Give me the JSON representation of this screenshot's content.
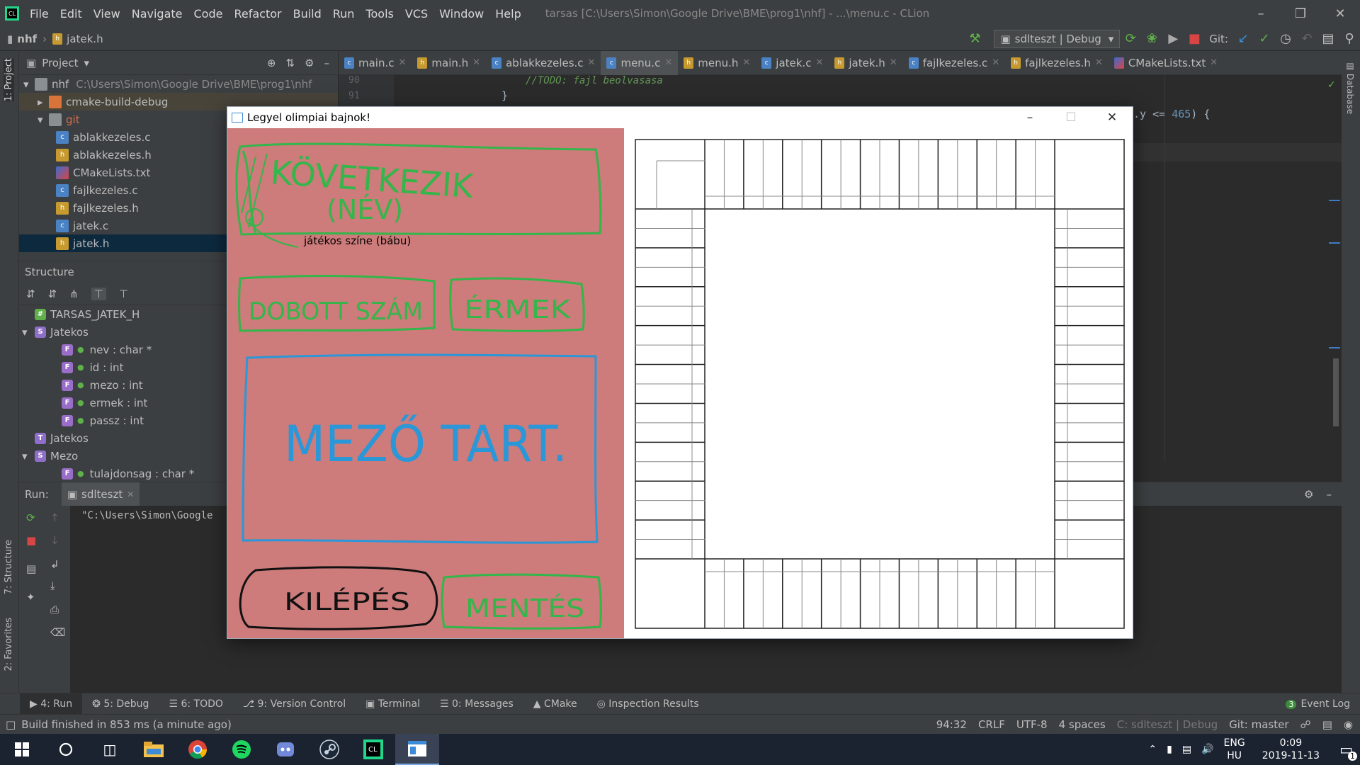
{
  "menu": [
    "File",
    "Edit",
    "View",
    "Navigate",
    "Code",
    "Refactor",
    "Build",
    "Run",
    "Tools",
    "VCS",
    "Window",
    "Help"
  ],
  "window_title": "tarsas [C:\\Users\\Simon\\Google Drive\\BME\\prog1\\nhf] - ...\\menu.c - CLion",
  "breadcrumb": {
    "project": "nhf",
    "file": "jatek.h"
  },
  "run_config": "sdlteszt | Debug",
  "git_label": "Git:",
  "project_panel": {
    "title": "Project",
    "tree": [
      {
        "label": "nhf",
        "extra": "C:\\Users\\Simon\\Google Drive\\BME\\prog1\\nhf",
        "kind": "folder"
      },
      {
        "label": "cmake-build-debug",
        "kind": "folder-orange"
      },
      {
        "label": "git",
        "kind": "folder"
      },
      {
        "label": "ablakkezeles.c",
        "kind": "c"
      },
      {
        "label": "ablakkezeles.h",
        "kind": "h"
      },
      {
        "label": "CMakeLists.txt",
        "kind": "cmake"
      },
      {
        "label": "fajlkezeles.c",
        "kind": "c"
      },
      {
        "label": "fajlkezeles.h",
        "kind": "h"
      },
      {
        "label": "jatek.c",
        "kind": "c"
      },
      {
        "label": "jatek.h",
        "kind": "h"
      }
    ]
  },
  "structure_panel": {
    "title": "Structure",
    "items": [
      {
        "badge": "#",
        "label": "TARSAS_JATEK_H",
        "level": 0
      },
      {
        "badge": "S",
        "label": "Jatekos",
        "level": 0
      },
      {
        "badge": "F",
        "label": "nev : char *",
        "level": 1
      },
      {
        "badge": "F",
        "label": "id : int",
        "level": 1
      },
      {
        "badge": "F",
        "label": "mezo : int",
        "level": 1
      },
      {
        "badge": "F",
        "label": "ermek : int",
        "level": 1
      },
      {
        "badge": "F",
        "label": "passz : int",
        "level": 1
      },
      {
        "badge": "T",
        "label": "Jatekos",
        "level": 0
      },
      {
        "badge": "S",
        "label": "Mezo",
        "level": 0
      },
      {
        "badge": "F",
        "label": "tulajdonsag : char *",
        "level": 1
      }
    ]
  },
  "tabs": [
    "main.c",
    "main.h",
    "ablakkezeles.c",
    "menu.c",
    "menu.h",
    "jatek.c",
    "jatek.h",
    "fajlkezeles.c",
    "fajlkezeles.h",
    "CMakeLists.txt"
  ],
  "editor": {
    "line_numbers": [
      "90",
      "91"
    ],
    "comment": "//TODO: fajl beolvasasa",
    "brace": "}",
    "snippet_prefix": ".y <= ",
    "snippet_number": "465",
    "snippet_suffix": ") {"
  },
  "run_panel": {
    "label": "Run:",
    "config": "sdlteszt",
    "output": "\"C:\\Users\\Simon\\Google"
  },
  "left_vertical_tabs": [
    "1: Project",
    "7: Structure",
    "2: Favorites"
  ],
  "right_vertical_tab": "Database",
  "bottom_tabs": [
    "4: Run",
    "5: Debug",
    "6: TODO",
    "9: Version Control",
    "Terminal",
    "0: Messages",
    "CMake",
    "Inspection Results"
  ],
  "event_log": {
    "count": "3",
    "label": "Event Log"
  },
  "status": {
    "message": "Build finished in 853 ms (a minute ago)",
    "position": "94:32",
    "line_sep": "CRLF",
    "encoding": "UTF-8",
    "indent": "4 spaces",
    "context": "C: sdlteszt | Debug",
    "git": "Git: master"
  },
  "taskbar": {
    "lang1": "ENG",
    "lang2": "HU",
    "time": "0:09",
    "date": "2019-11-13",
    "notif": "1"
  },
  "sdl_window": {
    "title": "Legyel olimpiai bajnok!",
    "handwriting": {
      "next_line1": "KÖVETKEZIK",
      "next_line2": "(NÉV)",
      "player_color": "játékos színe (bábu)",
      "dice": "DOBOTT SZÁM",
      "coins": "ÉRMEK",
      "field": "MEZŐ TART.",
      "exit": "KILÉPÉS",
      "save": "MENTÉS"
    },
    "colors": {
      "panel": "#cd7b7b",
      "green": "#33b64a",
      "blue": "#2a97d8",
      "black": "#111111"
    }
  }
}
